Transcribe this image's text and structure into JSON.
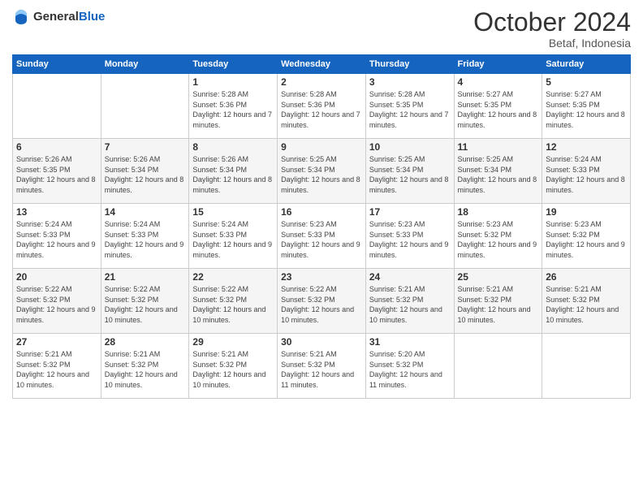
{
  "logo": {
    "general": "General",
    "blue": "Blue"
  },
  "header": {
    "month": "October 2024",
    "location": "Betaf, Indonesia"
  },
  "weekdays": [
    "Sunday",
    "Monday",
    "Tuesday",
    "Wednesday",
    "Thursday",
    "Friday",
    "Saturday"
  ],
  "weeks": [
    [
      {
        "day": "",
        "sunrise": "",
        "sunset": "",
        "daylight": ""
      },
      {
        "day": "",
        "sunrise": "",
        "sunset": "",
        "daylight": ""
      },
      {
        "day": "1",
        "sunrise": "Sunrise: 5:28 AM",
        "sunset": "Sunset: 5:36 PM",
        "daylight": "Daylight: 12 hours and 7 minutes."
      },
      {
        "day": "2",
        "sunrise": "Sunrise: 5:28 AM",
        "sunset": "Sunset: 5:36 PM",
        "daylight": "Daylight: 12 hours and 7 minutes."
      },
      {
        "day": "3",
        "sunrise": "Sunrise: 5:28 AM",
        "sunset": "Sunset: 5:35 PM",
        "daylight": "Daylight: 12 hours and 7 minutes."
      },
      {
        "day": "4",
        "sunrise": "Sunrise: 5:27 AM",
        "sunset": "Sunset: 5:35 PM",
        "daylight": "Daylight: 12 hours and 8 minutes."
      },
      {
        "day": "5",
        "sunrise": "Sunrise: 5:27 AM",
        "sunset": "Sunset: 5:35 PM",
        "daylight": "Daylight: 12 hours and 8 minutes."
      }
    ],
    [
      {
        "day": "6",
        "sunrise": "Sunrise: 5:26 AM",
        "sunset": "Sunset: 5:35 PM",
        "daylight": "Daylight: 12 hours and 8 minutes."
      },
      {
        "day": "7",
        "sunrise": "Sunrise: 5:26 AM",
        "sunset": "Sunset: 5:34 PM",
        "daylight": "Daylight: 12 hours and 8 minutes."
      },
      {
        "day": "8",
        "sunrise": "Sunrise: 5:26 AM",
        "sunset": "Sunset: 5:34 PM",
        "daylight": "Daylight: 12 hours and 8 minutes."
      },
      {
        "day": "9",
        "sunrise": "Sunrise: 5:25 AM",
        "sunset": "Sunset: 5:34 PM",
        "daylight": "Daylight: 12 hours and 8 minutes."
      },
      {
        "day": "10",
        "sunrise": "Sunrise: 5:25 AM",
        "sunset": "Sunset: 5:34 PM",
        "daylight": "Daylight: 12 hours and 8 minutes."
      },
      {
        "day": "11",
        "sunrise": "Sunrise: 5:25 AM",
        "sunset": "Sunset: 5:34 PM",
        "daylight": "Daylight: 12 hours and 8 minutes."
      },
      {
        "day": "12",
        "sunrise": "Sunrise: 5:24 AM",
        "sunset": "Sunset: 5:33 PM",
        "daylight": "Daylight: 12 hours and 8 minutes."
      }
    ],
    [
      {
        "day": "13",
        "sunrise": "Sunrise: 5:24 AM",
        "sunset": "Sunset: 5:33 PM",
        "daylight": "Daylight: 12 hours and 9 minutes."
      },
      {
        "day": "14",
        "sunrise": "Sunrise: 5:24 AM",
        "sunset": "Sunset: 5:33 PM",
        "daylight": "Daylight: 12 hours and 9 minutes."
      },
      {
        "day": "15",
        "sunrise": "Sunrise: 5:24 AM",
        "sunset": "Sunset: 5:33 PM",
        "daylight": "Daylight: 12 hours and 9 minutes."
      },
      {
        "day": "16",
        "sunrise": "Sunrise: 5:23 AM",
        "sunset": "Sunset: 5:33 PM",
        "daylight": "Daylight: 12 hours and 9 minutes."
      },
      {
        "day": "17",
        "sunrise": "Sunrise: 5:23 AM",
        "sunset": "Sunset: 5:33 PM",
        "daylight": "Daylight: 12 hours and 9 minutes."
      },
      {
        "day": "18",
        "sunrise": "Sunrise: 5:23 AM",
        "sunset": "Sunset: 5:32 PM",
        "daylight": "Daylight: 12 hours and 9 minutes."
      },
      {
        "day": "19",
        "sunrise": "Sunrise: 5:23 AM",
        "sunset": "Sunset: 5:32 PM",
        "daylight": "Daylight: 12 hours and 9 minutes."
      }
    ],
    [
      {
        "day": "20",
        "sunrise": "Sunrise: 5:22 AM",
        "sunset": "Sunset: 5:32 PM",
        "daylight": "Daylight: 12 hours and 9 minutes."
      },
      {
        "day": "21",
        "sunrise": "Sunrise: 5:22 AM",
        "sunset": "Sunset: 5:32 PM",
        "daylight": "Daylight: 12 hours and 10 minutes."
      },
      {
        "day": "22",
        "sunrise": "Sunrise: 5:22 AM",
        "sunset": "Sunset: 5:32 PM",
        "daylight": "Daylight: 12 hours and 10 minutes."
      },
      {
        "day": "23",
        "sunrise": "Sunrise: 5:22 AM",
        "sunset": "Sunset: 5:32 PM",
        "daylight": "Daylight: 12 hours and 10 minutes."
      },
      {
        "day": "24",
        "sunrise": "Sunrise: 5:21 AM",
        "sunset": "Sunset: 5:32 PM",
        "daylight": "Daylight: 12 hours and 10 minutes."
      },
      {
        "day": "25",
        "sunrise": "Sunrise: 5:21 AM",
        "sunset": "Sunset: 5:32 PM",
        "daylight": "Daylight: 12 hours and 10 minutes."
      },
      {
        "day": "26",
        "sunrise": "Sunrise: 5:21 AM",
        "sunset": "Sunset: 5:32 PM",
        "daylight": "Daylight: 12 hours and 10 minutes."
      }
    ],
    [
      {
        "day": "27",
        "sunrise": "Sunrise: 5:21 AM",
        "sunset": "Sunset: 5:32 PM",
        "daylight": "Daylight: 12 hours and 10 minutes."
      },
      {
        "day": "28",
        "sunrise": "Sunrise: 5:21 AM",
        "sunset": "Sunset: 5:32 PM",
        "daylight": "Daylight: 12 hours and 10 minutes."
      },
      {
        "day": "29",
        "sunrise": "Sunrise: 5:21 AM",
        "sunset": "Sunset: 5:32 PM",
        "daylight": "Daylight: 12 hours and 10 minutes."
      },
      {
        "day": "30",
        "sunrise": "Sunrise: 5:21 AM",
        "sunset": "Sunset: 5:32 PM",
        "daylight": "Daylight: 12 hours and 11 minutes."
      },
      {
        "day": "31",
        "sunrise": "Sunrise: 5:20 AM",
        "sunset": "Sunset: 5:32 PM",
        "daylight": "Daylight: 12 hours and 11 minutes."
      },
      {
        "day": "",
        "sunrise": "",
        "sunset": "",
        "daylight": ""
      },
      {
        "day": "",
        "sunrise": "",
        "sunset": "",
        "daylight": ""
      }
    ]
  ]
}
